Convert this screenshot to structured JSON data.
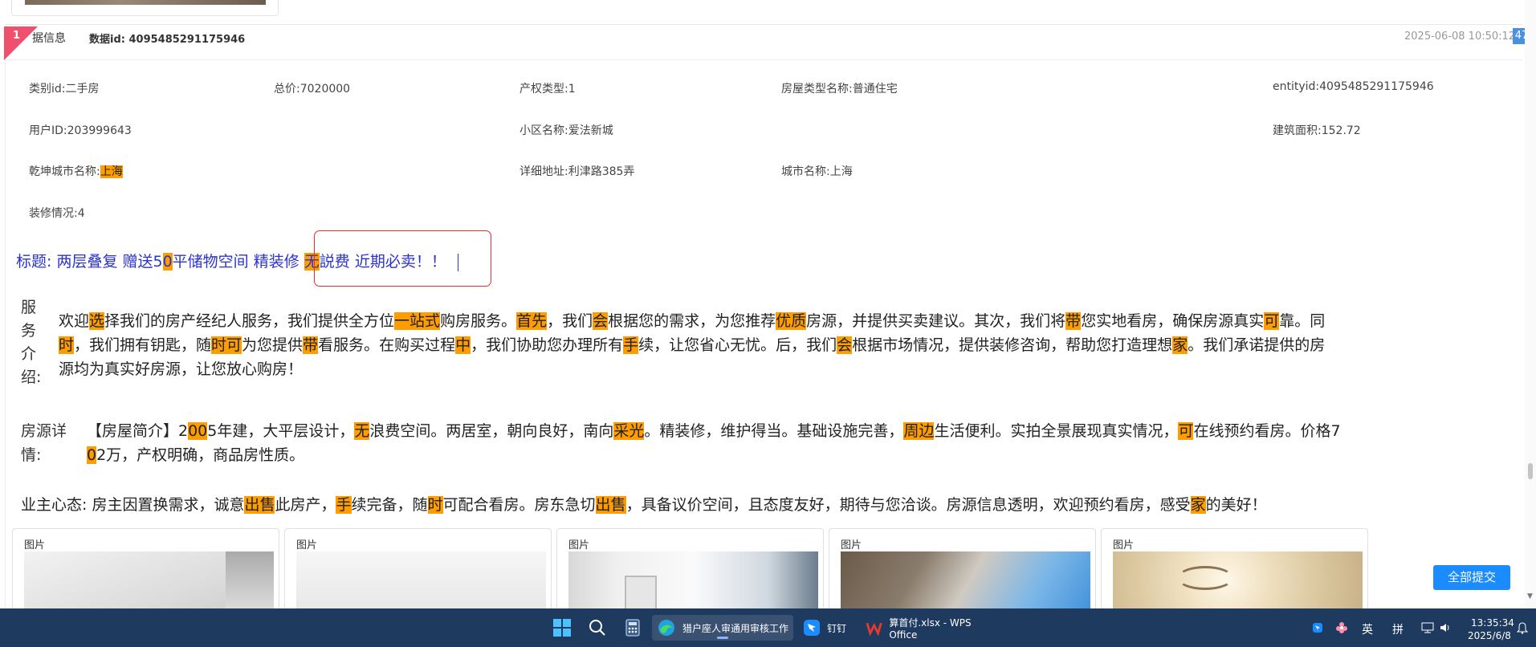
{
  "header": {
    "ribbon_num": "1",
    "label": "据信息",
    "data_id": "数据id: 4095485291175946",
    "timestamp": "2025-06-08 10:50:12",
    "badge": "47"
  },
  "fields": {
    "category": "类别id:二手房",
    "total_price": "总价:7020000",
    "property_right": "产权类型:1",
    "house_type": "房屋类型名称:普通住宅",
    "entity_id": "entityid:4095485291175946",
    "user_id": "用户ID:203999643",
    "community": "小区名称:爱法新城",
    "area": "建筑面积:152.72",
    "qk_city_prefix": "乾坤城市名称:",
    "qk_city_value": "上海",
    "address": "详细地址:利津路385弄",
    "city": "城市名称:上海",
    "decoration": "装修情况:4"
  },
  "title": {
    "s1": "标题: 两层叠复 赠送5",
    "h1": "0",
    "s2": "平储物空间 精装修 ",
    "h2": "无",
    "s3": "説费 近期必卖！！"
  },
  "service": {
    "label_chars": [
      "服",
      "务",
      "介",
      "绍:"
    ],
    "line1": [
      {
        "t": "欢迎"
      },
      {
        "t": "选",
        "h": true
      },
      {
        "t": "择我们的房产经纪人服务，我们提供全方位"
      },
      {
        "t": "一站式",
        "h": true
      },
      {
        "t": "购房服务。"
      },
      {
        "t": "首先",
        "h": true
      },
      {
        "t": "，我们"
      },
      {
        "t": "会",
        "h": true
      },
      {
        "t": "根据您的需求，为您推荐"
      },
      {
        "t": "优质",
        "h": true
      },
      {
        "t": "房源，并提供买卖建议。其次，我们将"
      },
      {
        "t": "带",
        "h": true
      },
      {
        "t": "您实地看房，确保房源真实"
      },
      {
        "t": "可",
        "h": true
      },
      {
        "t": "靠。同"
      }
    ],
    "line2": [
      {
        "t": "时",
        "h": true
      },
      {
        "t": "，我们拥有钥匙，随"
      },
      {
        "t": "时可",
        "h": true
      },
      {
        "t": "为您提供"
      },
      {
        "t": "带",
        "h": true
      },
      {
        "t": "看服务。在购买过程"
      },
      {
        "t": "中",
        "h": true
      },
      {
        "t": "，我们协助您办理所有"
      },
      {
        "t": "手",
        "h": true
      },
      {
        "t": "续，让您省心无忧。后，我们"
      },
      {
        "t": "会",
        "h": true
      },
      {
        "t": "根据市场情况，提供装修咨询，帮助您打造理想"
      },
      {
        "t": "家",
        "h": true
      },
      {
        "t": "。我们承诺提供的房"
      }
    ],
    "line3": [
      {
        "t": "源均为真实好房源，让您放心购房！"
      }
    ]
  },
  "detail": {
    "label_l1": "房源详",
    "label_l2": "情:",
    "line1": [
      {
        "t": "【房屋简介】2"
      },
      {
        "t": "00",
        "h": true
      },
      {
        "t": "5年建，大平层设计，"
      },
      {
        "t": "无",
        "h": true
      },
      {
        "t": "浪费空间。两居室，朝向良好，南向"
      },
      {
        "t": "采光",
        "h": true
      },
      {
        "t": "。精装修，维护得当。基础设施完善，"
      },
      {
        "t": "周边",
        "h": true
      },
      {
        "t": "生活便利。实拍全景展现真实情况，"
      },
      {
        "t": "可",
        "h": true
      },
      {
        "t": "在线预约看房。价格7"
      }
    ],
    "line2": [
      {
        "t": "0",
        "h": true
      },
      {
        "t": "2万，产权明确，商品房性质。"
      }
    ]
  },
  "owner": {
    "line": [
      {
        "t": "业主心态: 房主因置换需求，诚意"
      },
      {
        "t": "出售",
        "h": true
      },
      {
        "t": "此房产，"
      },
      {
        "t": "手",
        "h": true
      },
      {
        "t": "续完备，随"
      },
      {
        "t": "时",
        "h": true
      },
      {
        "t": "可配合看房。房东急切"
      },
      {
        "t": "出售",
        "h": true
      },
      {
        "t": "，具备议价空间，且态度友好，期待与您洽谈。房源信息透明，欢迎预约看房，感受"
      },
      {
        "t": "家",
        "h": true
      },
      {
        "t": "的美好！"
      }
    ]
  },
  "photos": {
    "label": "图片",
    "items": [
      "photo-1",
      "photo-2",
      "photo-3",
      "photo-4",
      "photo-5"
    ]
  },
  "actions": {
    "submit_all": "全部提交"
  },
  "taskbar": {
    "app1": "猎户座人审通用审核工作",
    "app2": "钉钉",
    "app3": "算首付.xlsx - WPS Office",
    "ime1": "英",
    "ime2": "拼",
    "time": "13:35:34",
    "date": "2025/6/8"
  }
}
